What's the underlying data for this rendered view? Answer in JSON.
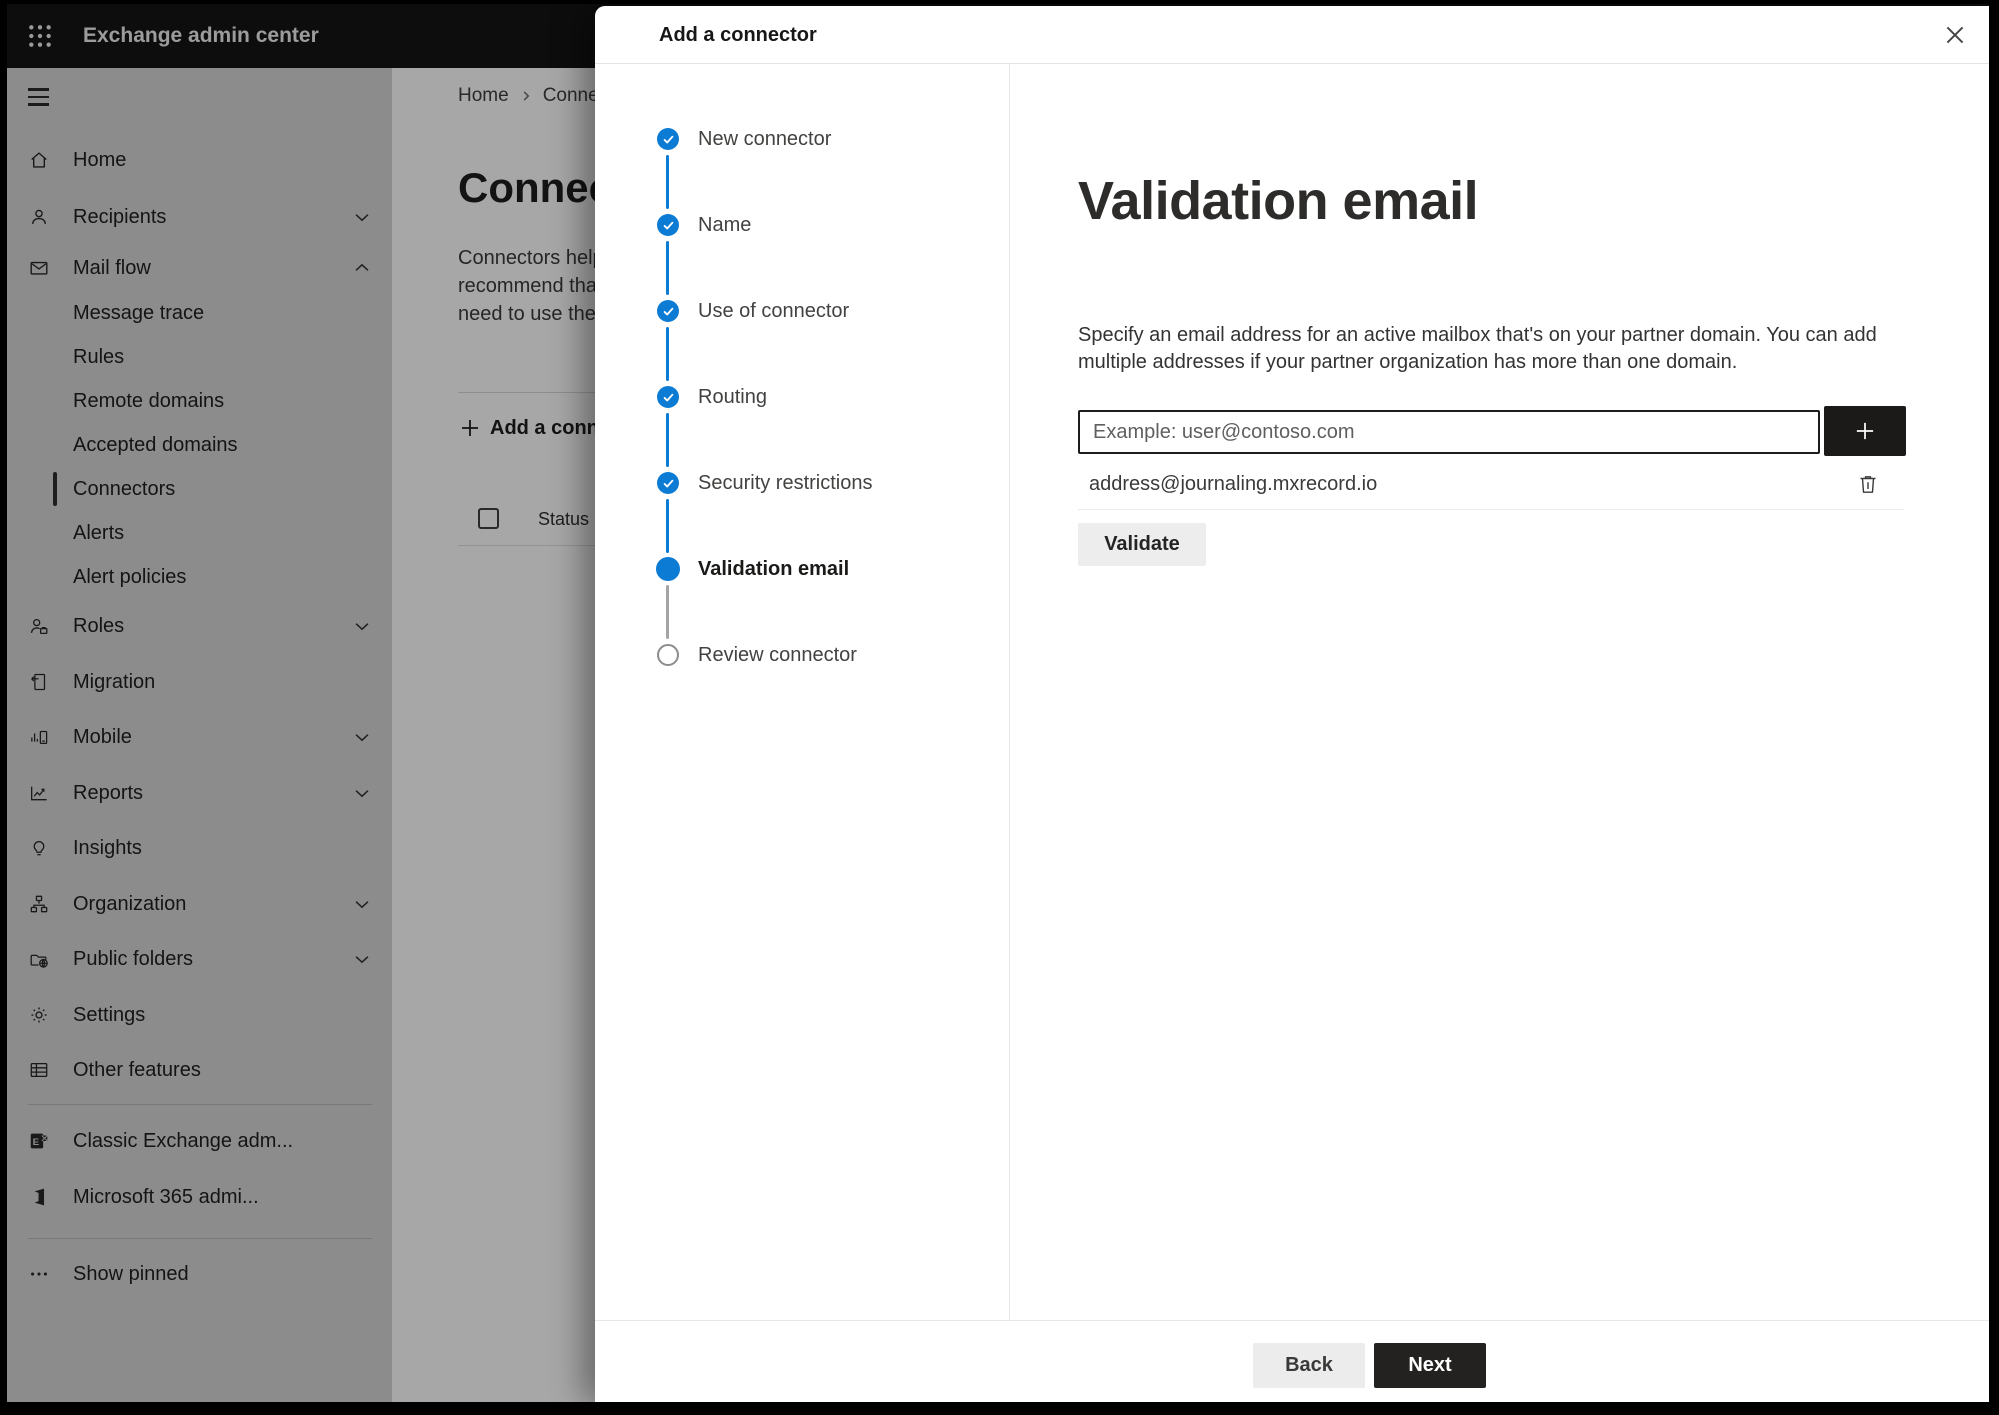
{
  "app": {
    "title": "Exchange admin center",
    "launcher_icon": "waffle-icon"
  },
  "sidebar": {
    "menu_icon": "hamburger-icon",
    "top": [
      {
        "label": "Home",
        "icon": "home"
      },
      {
        "label": "Recipients",
        "icon": "person",
        "chevron": "down"
      },
      {
        "label": "Mail flow",
        "icon": "mail",
        "chevron": "up",
        "expanded": true
      }
    ],
    "mail_flow_children": [
      {
        "label": "Message trace"
      },
      {
        "label": "Rules"
      },
      {
        "label": "Remote domains"
      },
      {
        "label": "Accepted domains"
      },
      {
        "label": "Connectors",
        "selected": true
      },
      {
        "label": "Alerts"
      },
      {
        "label": "Alert policies"
      }
    ],
    "middle": [
      {
        "label": "Roles",
        "icon": "roles",
        "chevron": "down"
      },
      {
        "label": "Migration",
        "icon": "migration"
      },
      {
        "label": "Mobile",
        "icon": "mobile",
        "chevron": "down"
      },
      {
        "label": "Reports",
        "icon": "reports",
        "chevron": "down"
      },
      {
        "label": "Insights",
        "icon": "insights"
      },
      {
        "label": "Organization",
        "icon": "organization",
        "chevron": "down"
      },
      {
        "label": "Public folders",
        "icon": "public-folders",
        "chevron": "down"
      },
      {
        "label": "Settings",
        "icon": "settings"
      },
      {
        "label": "Other features",
        "icon": "other-features"
      }
    ],
    "footer": [
      {
        "label": "Classic Exchange adm...",
        "icon": "exchange-logo"
      },
      {
        "label": "Microsoft 365 admi...",
        "icon": "microsoft-365-logo"
      }
    ],
    "show_pinned_label": "Show pinned",
    "show_pinned_icon": "ellipsis-icon"
  },
  "main": {
    "breadcrumb": [
      "Home",
      "Connectors"
    ],
    "page_title": "Connectors",
    "description_lines": [
      "Connectors help",
      "recommend that",
      "need to use them"
    ],
    "add_button_label": "Add a connector",
    "table": {
      "first_column_header": "Status"
    }
  },
  "dialog": {
    "title": "Add a connector",
    "close_icon": "x-icon",
    "steps": [
      {
        "label": "New connector",
        "state": "complete"
      },
      {
        "label": "Name",
        "state": "complete"
      },
      {
        "label": "Use of connector",
        "state": "complete"
      },
      {
        "label": "Routing",
        "state": "complete"
      },
      {
        "label": "Security restrictions",
        "state": "complete"
      },
      {
        "label": "Validation email",
        "state": "current"
      },
      {
        "label": "Review connector",
        "state": "upcoming"
      }
    ],
    "content": {
      "heading": "Validation email",
      "description": "Specify an email address for an active mailbox that's on your partner domain. You can add multiple addresses if your partner organization has more than one domain.",
      "email_input_placeholder": "Example: user@contoso.com",
      "add_address_icon": "plus-icon",
      "added_address": "address@journaling.mxrecord.io",
      "remove_address_icon": "trash-icon",
      "validate_button_label": "Validate"
    },
    "footer": {
      "back_label": "Back",
      "next_label": "Next"
    }
  },
  "colors": {
    "accent_blue": "#0b7bd4",
    "appbar_bg": "#141414",
    "primary_button_bg": "#242220",
    "sidebar_bg": "#d5d5d5",
    "overlay": "rgba(0,0,0,0.34)"
  }
}
